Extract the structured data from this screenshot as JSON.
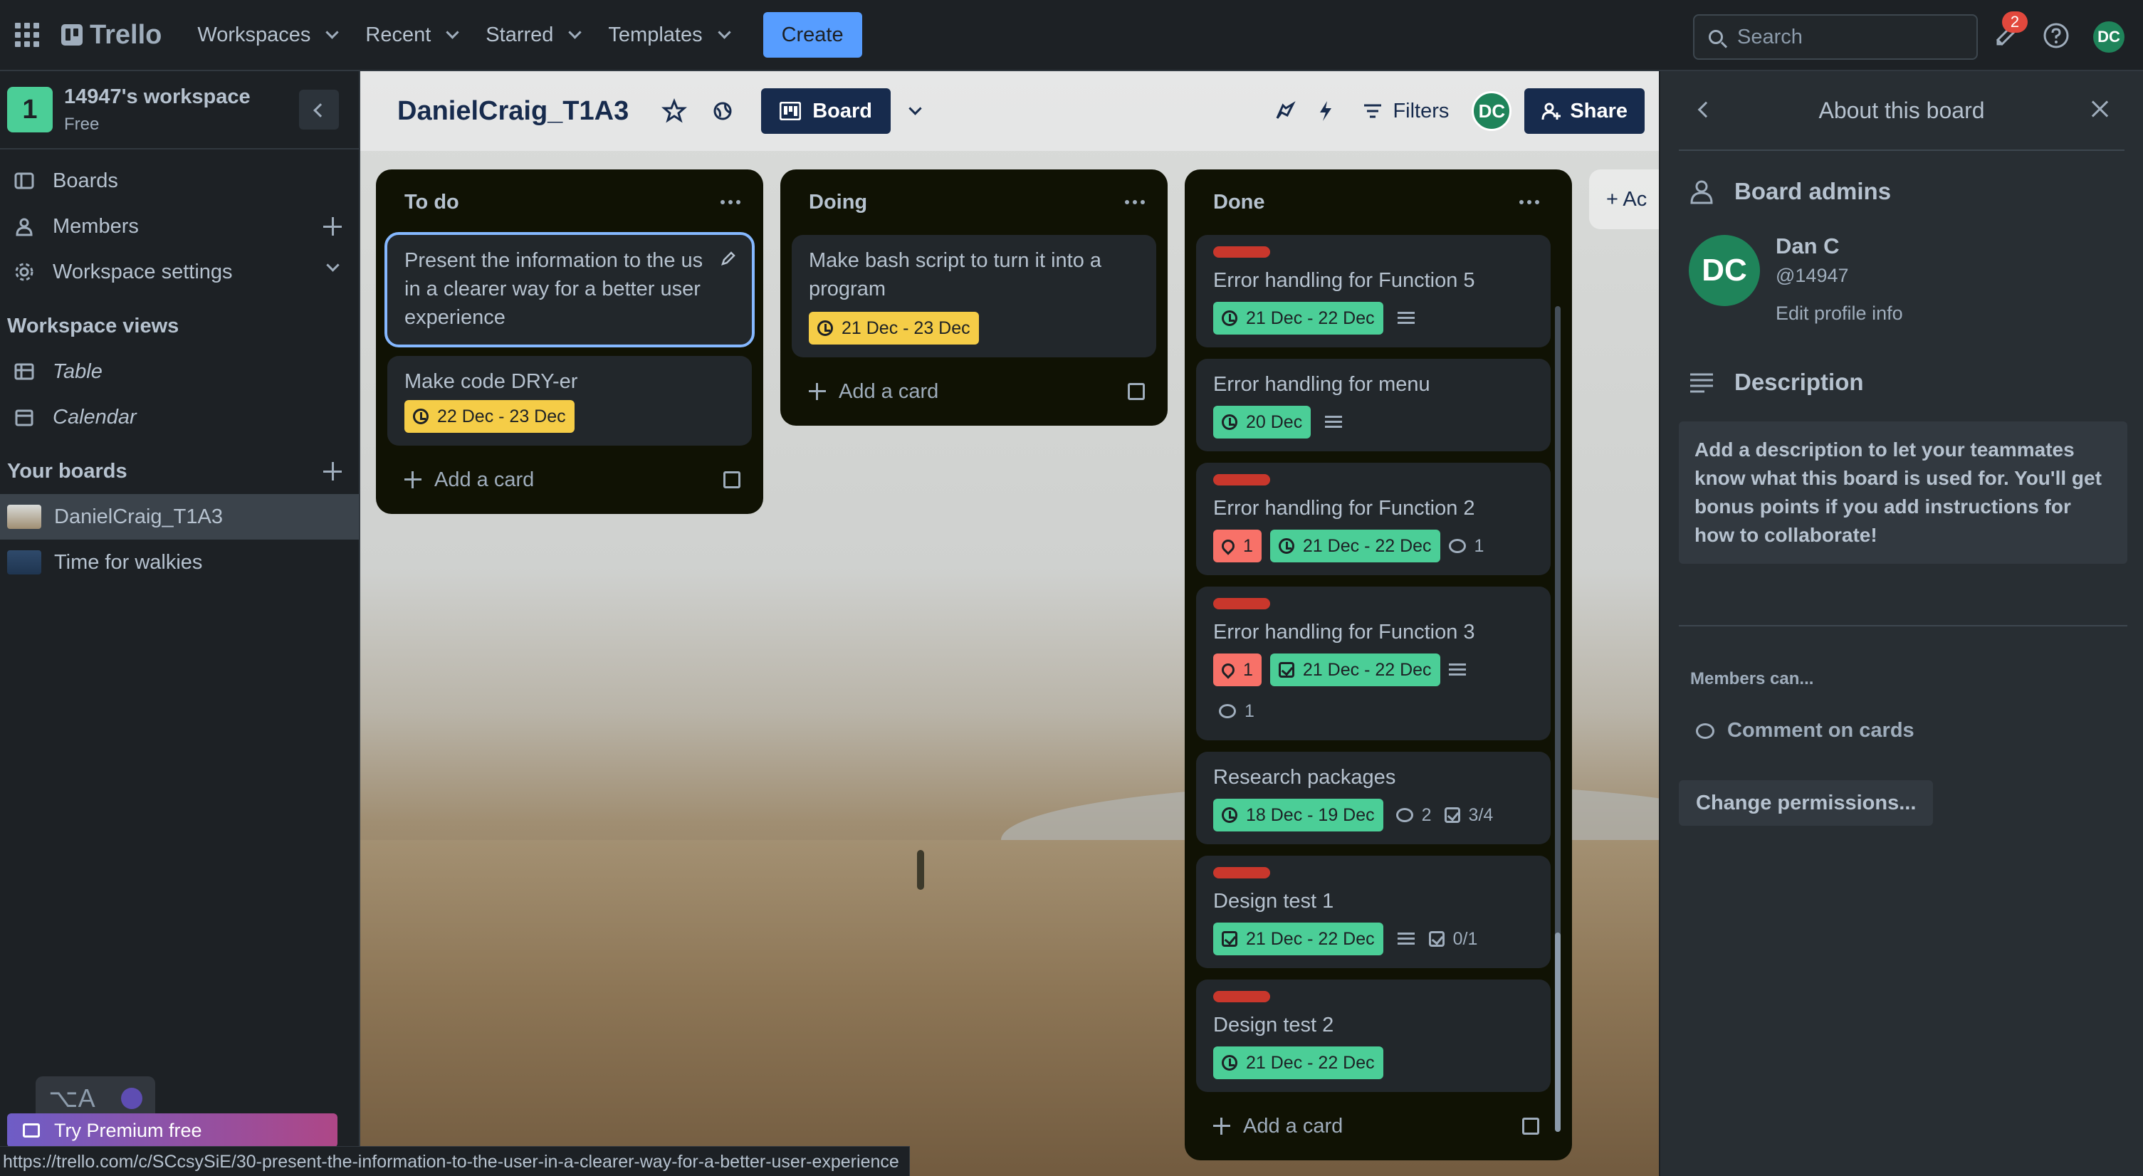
{
  "topbar": {
    "app_name": "Trello",
    "menus": [
      "Workspaces",
      "Recent",
      "Starred",
      "Templates"
    ],
    "create_label": "Create",
    "search_placeholder": "Search",
    "notification_count": "2",
    "user_initials": "DC"
  },
  "sidebar": {
    "workspace_initial": "1",
    "workspace_name": "14947's workspace",
    "workspace_plan": "Free",
    "nav": [
      {
        "label": "Boards",
        "icon": "board-icon"
      },
      {
        "label": "Members",
        "icon": "person-icon"
      },
      {
        "label": "Workspace settings",
        "icon": "gear-icon"
      }
    ],
    "views_title": "Workspace views",
    "views": [
      {
        "label": "Table",
        "icon": "table-icon"
      },
      {
        "label": "Calendar",
        "icon": "calendar-icon"
      }
    ],
    "boards_title": "Your boards",
    "boards": [
      {
        "label": "DanielCraig_T1A3",
        "active": true
      },
      {
        "label": "Time for walkies",
        "active": false
      }
    ],
    "premium_label": "Try Premium free"
  },
  "board": {
    "title": "DanielCraig_T1A3",
    "view_label": "Board",
    "filters_label": "Filters",
    "member_initials": "DC",
    "share_label": "Share",
    "add_list_label": "+ Ac"
  },
  "lists": [
    {
      "title": "To do",
      "add_card": "Add a card",
      "cards": [
        {
          "title": "Present the information to the us in a clearer way for a better user experience",
          "date": ""
        },
        {
          "title": "Make code DRY-er",
          "date": "22 Dec - 23 Dec"
        }
      ]
    },
    {
      "title": "Doing",
      "add_card": "Add a card",
      "cards": [
        {
          "title": "Make bash script to turn it into a program",
          "date": "21 Dec - 23 Dec"
        }
      ]
    },
    {
      "title": "Done",
      "add_card": "Add a card",
      "cards": [
        {
          "title": "Error handling for Function 5",
          "date": "21 Dec - 22 Dec"
        },
        {
          "title": "Error handling for menu",
          "date": "20 Dec"
        },
        {
          "title": "Error handling for Function 2",
          "votes": "1",
          "date": "21 Dec - 22 Dec",
          "comments": "1"
        },
        {
          "title": "Error handling for Function 3",
          "votes": "1",
          "date": "21 Dec - 22 Dec",
          "comments": "1"
        },
        {
          "title": "Research packages",
          "date": "18 Dec - 19 Dec",
          "comments": "2",
          "checklist": "3/4"
        },
        {
          "title": "Design test 1",
          "date": "21 Dec - 22 Dec",
          "checklist": "0/1"
        },
        {
          "title": "Design test 2",
          "date": "21 Dec - 22 Dec"
        }
      ]
    }
  ],
  "panel": {
    "title": "About this board",
    "admins_title": "Board admins",
    "admin_initials": "DC",
    "admin_name": "Dan C",
    "admin_handle": "@14947",
    "edit_profile": "Edit profile info",
    "description_title": "Description",
    "description_text": "Add a description to let your teammates know what this board is used for. You'll get bonus points if you add instructions for how to collaborate!",
    "members_can": "Members can...",
    "comment_permission": "Comment on cards",
    "change_permissions": "Change permissions..."
  },
  "status_url": "https://trello.com/c/SCcsySiE/30-present-the-information-to-the-user-in-a-clearer-way-for-a-better-user-experience",
  "colors": {
    "accent": "#579dff",
    "date_green": "#4bce97",
    "date_yellow": "#f5cd47",
    "label_red": "#c9372c",
    "avatar_green": "#1f845a"
  }
}
